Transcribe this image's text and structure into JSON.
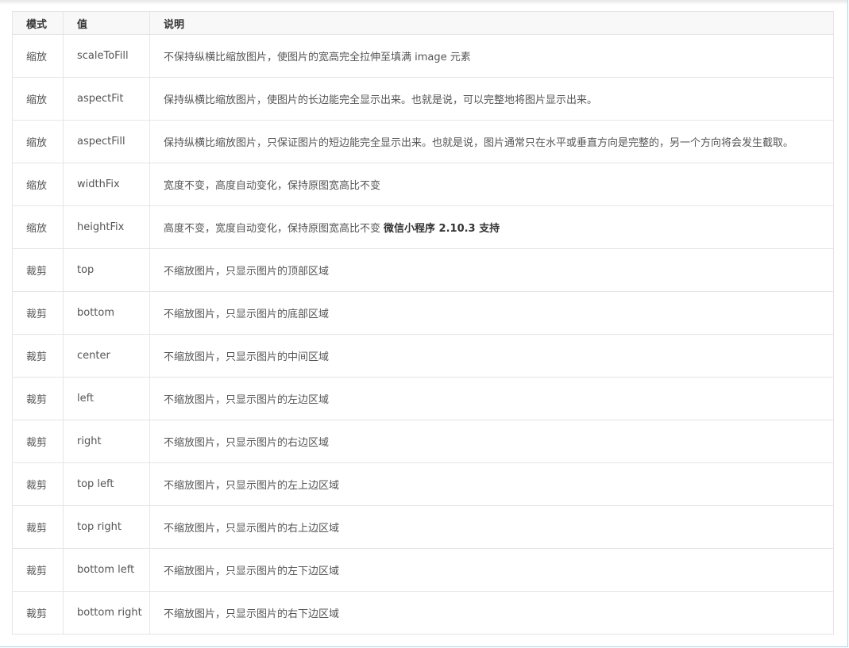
{
  "table": {
    "headers": [
      "模式",
      "值",
      "说明"
    ],
    "rows": [
      {
        "mode": "缩放",
        "value": "scaleToFill",
        "desc": "不保持纵横比缩放图片，使图片的宽高完全拉伸至填满 image 元素",
        "note": ""
      },
      {
        "mode": "缩放",
        "value": "aspectFit",
        "desc": "保持纵横比缩放图片，使图片的长边能完全显示出来。也就是说，可以完整地将图片显示出来。",
        "note": ""
      },
      {
        "mode": "缩放",
        "value": "aspectFill",
        "desc": "保持纵横比缩放图片，只保证图片的短边能完全显示出来。也就是说，图片通常只在水平或垂直方向是完整的，另一个方向将会发生截取。",
        "note": ""
      },
      {
        "mode": "缩放",
        "value": "widthFix",
        "desc": "宽度不变，高度自动变化，保持原图宽高比不变",
        "note": ""
      },
      {
        "mode": "缩放",
        "value": "heightFix",
        "desc": "高度不变，宽度自动变化，保持原图宽高比不变",
        "note": "微信小程序 2.10.3 支持"
      },
      {
        "mode": "裁剪",
        "value": "top",
        "desc": "不缩放图片，只显示图片的顶部区域",
        "note": ""
      },
      {
        "mode": "裁剪",
        "value": "bottom",
        "desc": "不缩放图片，只显示图片的底部区域",
        "note": ""
      },
      {
        "mode": "裁剪",
        "value": "center",
        "desc": "不缩放图片，只显示图片的中间区域",
        "note": ""
      },
      {
        "mode": "裁剪",
        "value": "left",
        "desc": "不缩放图片，只显示图片的左边区域",
        "note": ""
      },
      {
        "mode": "裁剪",
        "value": "right",
        "desc": "不缩放图片，只显示图片的右边区域",
        "note": ""
      },
      {
        "mode": "裁剪",
        "value": "top left",
        "desc": "不缩放图片，只显示图片的左上边区域",
        "note": ""
      },
      {
        "mode": "裁剪",
        "value": "top right",
        "desc": "不缩放图片，只显示图片的右上边区域",
        "note": ""
      },
      {
        "mode": "裁剪",
        "value": "bottom left",
        "desc": "不缩放图片，只显示图片的左下边区域",
        "note": ""
      },
      {
        "mode": "裁剪",
        "value": "bottom right",
        "desc": "不缩放图片，只显示图片的右下边区域",
        "note": ""
      }
    ]
  }
}
